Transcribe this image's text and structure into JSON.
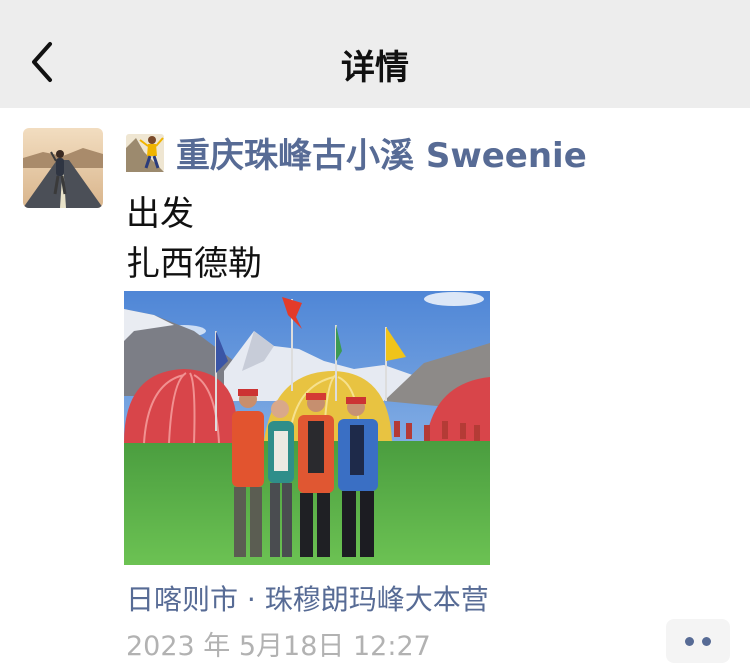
{
  "header": {
    "title": "详情",
    "back_icon": "chevron-left-icon"
  },
  "post": {
    "avatar_icon": "runner-avatar-image",
    "badge_icon": "climber-badge-icon",
    "username": "重庆珠峰古小溪 Sweenie",
    "text_line_1": "出发",
    "text_line_2": "扎西德勒",
    "photo_icon": "everest-base-camp-photo",
    "location": "日喀则市 · 珠穆朗玛峰大本营",
    "timestamp": "2023 年 5月18日 12:27",
    "more_icon": "more-dots-icon"
  },
  "colors": {
    "link": "#576b95",
    "header_bg": "#ededed",
    "timestamp": "#b2b2b2"
  }
}
